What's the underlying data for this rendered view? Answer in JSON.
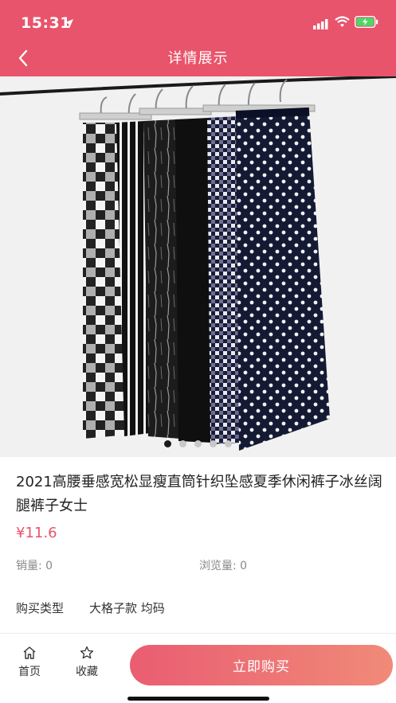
{
  "status_bar": {
    "time": "15:31",
    "icons": [
      "location-arrow-icon",
      "signal-icon",
      "wifi-icon",
      "battery-charging-icon"
    ]
  },
  "nav": {
    "title": "详情展示",
    "back_icon": "chevron-left-icon"
  },
  "colors": {
    "header_bg": "#e8546b",
    "price": "#e8546b",
    "buy_button": "#ea5d72",
    "battery_fill": "#4cd964"
  },
  "product": {
    "title": "2021高腰垂感宽松显瘦直筒针织坠感夏季休闲裤子冰丝阔腿裤子女士",
    "price": "¥11.6",
    "sales": "销量: 0",
    "views": "浏览量: 0",
    "buy_type_label": "购买类型",
    "buy_type_value": "大格子款 均码",
    "image_carousel": {
      "total": 5,
      "active_index": 0
    }
  },
  "bottom_bar": {
    "home": {
      "label": "首页",
      "icon": "home-icon"
    },
    "favorite": {
      "label": "收藏",
      "icon": "star-icon"
    },
    "buy_button": "立即购买"
  }
}
